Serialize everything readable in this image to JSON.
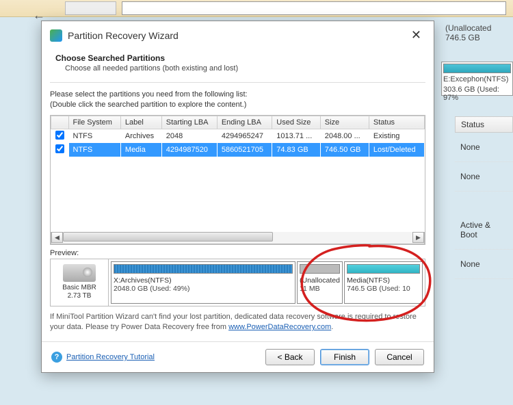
{
  "bg": {
    "unallocated_label": "(Unallocated",
    "unallocated_size": "746.5 GB",
    "excephon_label": "E:Excephon(NTFS)",
    "excephon_size": "303.6 GB (Used: 97%",
    "status_header": "Status",
    "status_rows": [
      "None",
      "None",
      "Active & Boot",
      "None"
    ]
  },
  "dialog": {
    "title": "Partition Recovery Wizard",
    "heading": "Choose Searched Partitions",
    "subheading": "Choose all needed partitions (both existing and lost)",
    "instruction1": "Please select the partitions you need from the following list:",
    "instruction2": "(Double click the searched partition to explore the content.)",
    "columns": {
      "c1": "File System",
      "c2": "Label",
      "c3": "Starting LBA",
      "c4": "Ending LBA",
      "c5": "Used Size",
      "c6": "Size",
      "c7": "Status"
    },
    "rows": [
      {
        "fs": "NTFS",
        "label": "Archives",
        "start": "2048",
        "end": "4294965247",
        "used": "1013.71 ...",
        "size": "2048.00 ...",
        "status": "Existing",
        "selected": false,
        "checked": true
      },
      {
        "fs": "NTFS",
        "label": "Media",
        "start": "4294987520",
        "end": "5860521705",
        "used": "74.83 GB",
        "size": "746.50 GB",
        "status": "Lost/Deleted",
        "selected": true,
        "checked": true
      }
    ],
    "preview_label": "Preview:",
    "disk": {
      "type": "Basic MBR",
      "size": "2.73 TB"
    },
    "parts": {
      "main": {
        "name": "X:Archives(NTFS)",
        "size": "2048.0 GB (Used: 49%)"
      },
      "unalloc": {
        "name": "(Unallocated",
        "size": "11 MB"
      },
      "media": {
        "name": "Media(NTFS)",
        "size": "746.5 GB (Used: 10"
      }
    },
    "footnote_pre": "If MiniTool Partition Wizard can't find your lost partition, dedicated data recovery software is required to restore your data. Please try Power Data Recovery free from ",
    "footnote_link": "www.PowerDataRecovery.com",
    "footnote_post": ".",
    "tutorial": "Partition Recovery Tutorial",
    "back": "< Back",
    "finish": "Finish",
    "cancel": "Cancel"
  }
}
